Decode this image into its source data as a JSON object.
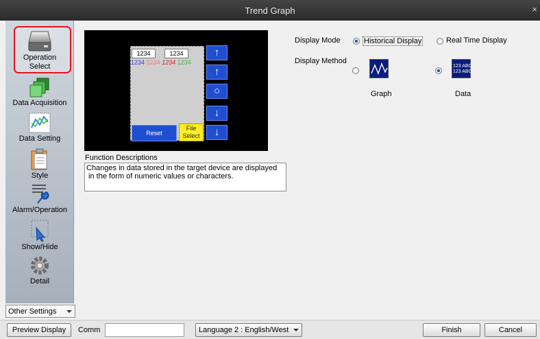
{
  "window": {
    "title": "Trend Graph",
    "close": "×"
  },
  "sidebar": {
    "items": [
      {
        "label_line1": "Operation",
        "label_line2": "Select",
        "icon": "operation-select-icon",
        "selected": true
      },
      {
        "label": "Data Acquisition",
        "icon": "data-acquisition-icon"
      },
      {
        "label": "Data Setting",
        "icon": "data-setting-icon"
      },
      {
        "label": "Style",
        "icon": "style-icon"
      },
      {
        "label": "Alarm/Operation",
        "icon": "alarm-operation-icon"
      },
      {
        "label": "Show/Hide",
        "icon": "show-hide-icon"
      },
      {
        "label": "Detail",
        "icon": "detail-icon"
      }
    ],
    "other_settings": "Other Settings"
  },
  "preview": {
    "num1": "1234",
    "num2": "1234",
    "row": [
      "1234",
      "1234",
      "1234",
      "1234"
    ],
    "reset": "Reset",
    "file_line1": "File",
    "file_line2": "Select",
    "colors": {
      "bg": "#000000",
      "button": "#1f4fd0",
      "file": "#ffef22"
    }
  },
  "function_descriptions": {
    "title": "Function Descriptions",
    "text_line1": "Changes in data stored in the target device are displayed",
    "text_line2": " in the form of numeric values or characters."
  },
  "display_mode": {
    "label": "Display Mode",
    "options": [
      "Historical Display",
      "Real Time Display"
    ],
    "selected": "Historical Display"
  },
  "display_method": {
    "label": "Display Method",
    "options": [
      "Graph",
      "Data"
    ],
    "selected": "Data",
    "data_icon_line1": "123 ABC",
    "data_icon_line2": "123 ABC"
  },
  "footer": {
    "preview_display": "Preview Display",
    "comm_label": "Comm",
    "comm_value": "",
    "language": "Language 2 : English/West",
    "finish": "Finish",
    "cancel": "Cancel"
  }
}
